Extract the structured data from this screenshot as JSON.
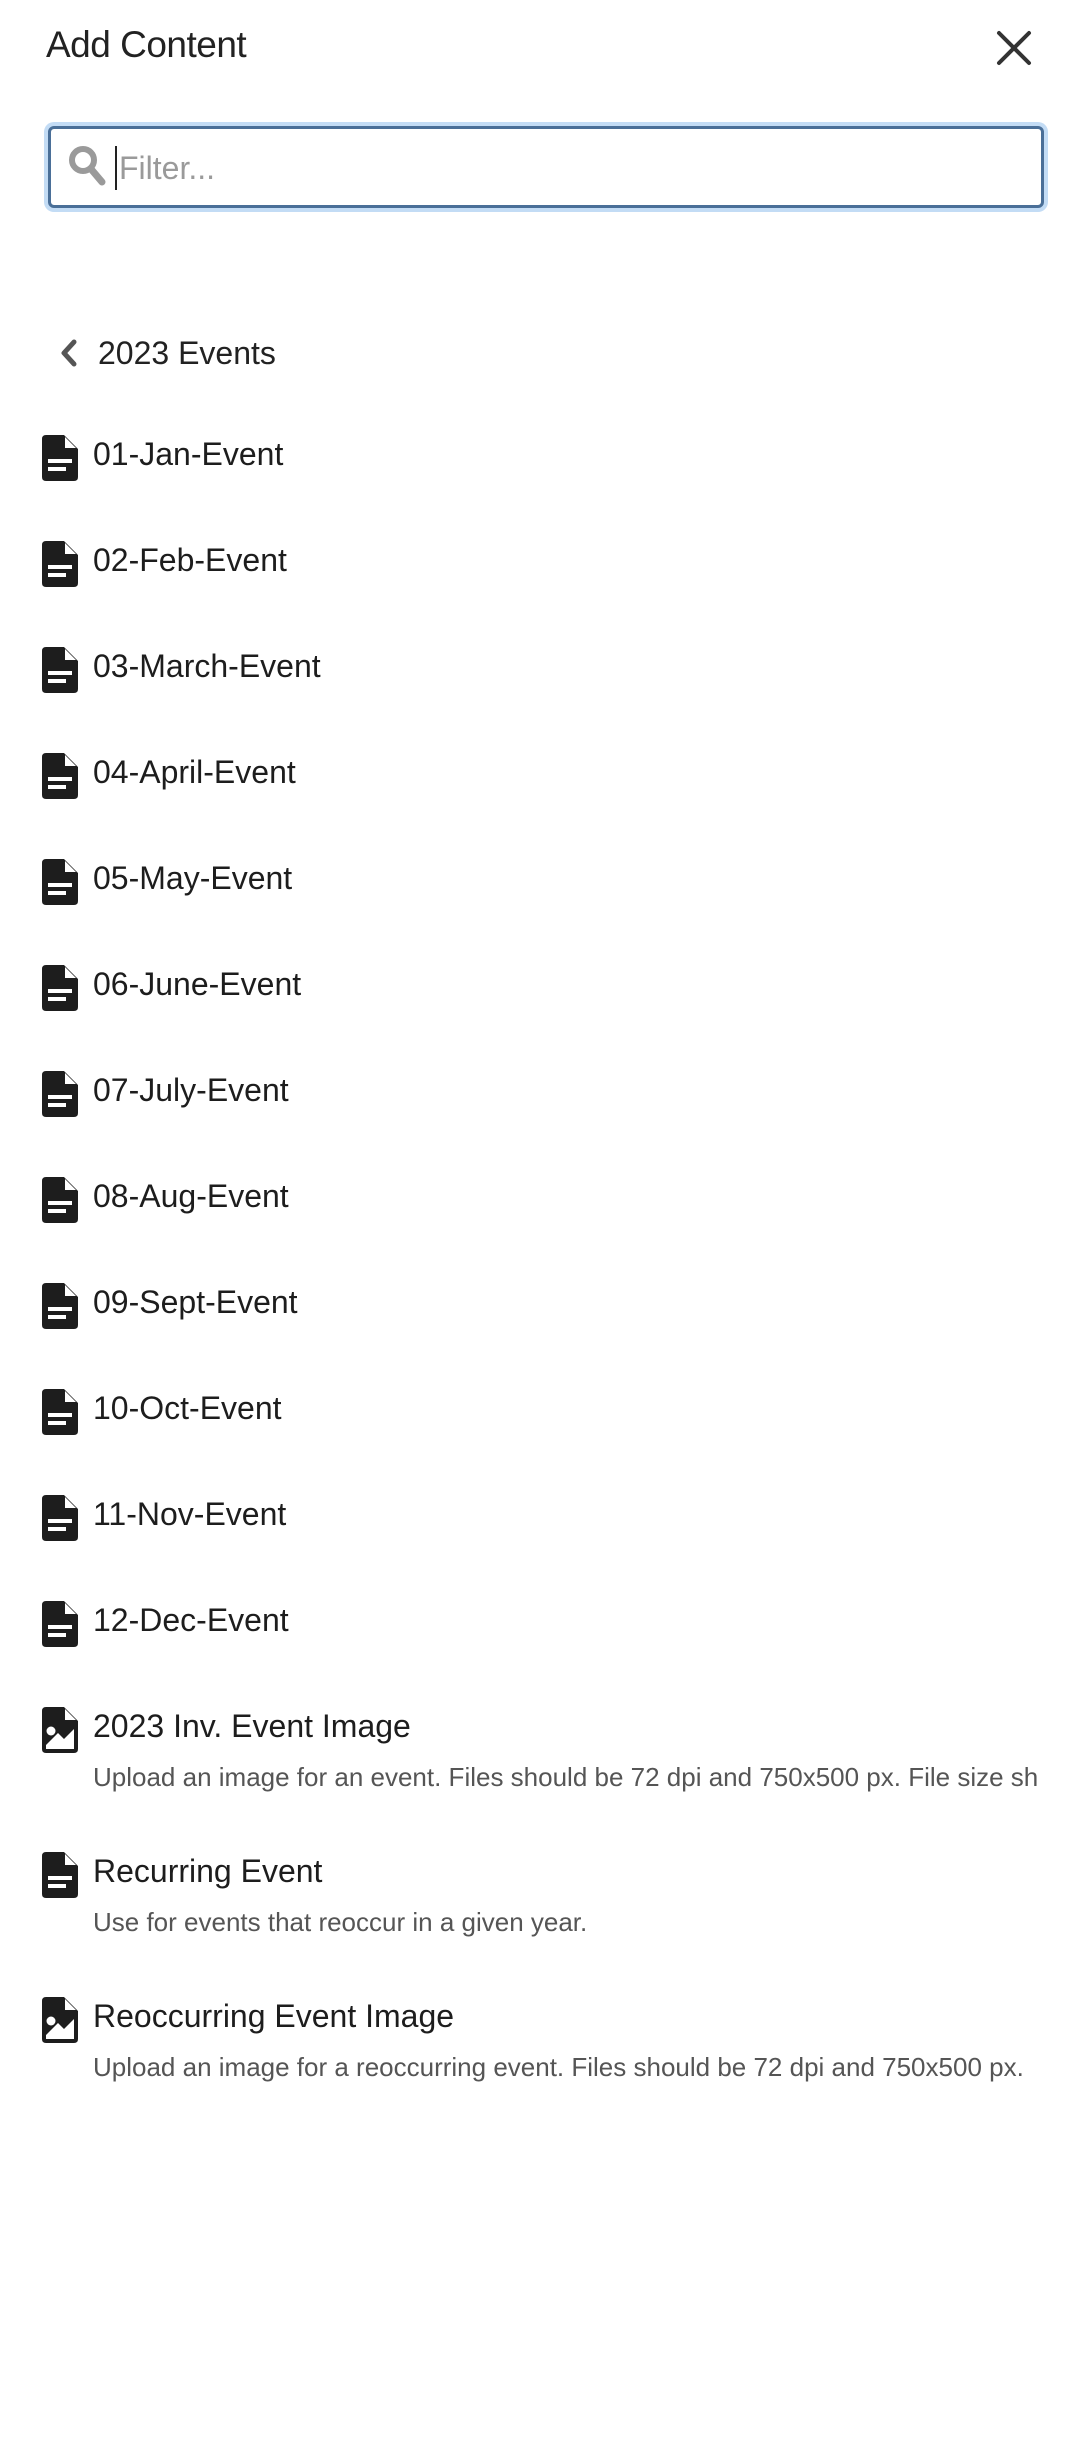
{
  "header": {
    "title": "Add Content",
    "close_icon": "close-icon"
  },
  "filter": {
    "placeholder": "Filter...",
    "value": "",
    "icon": "search-icon"
  },
  "breadcrumb": {
    "back_icon": "chevron-left-icon",
    "label": "2023 Events"
  },
  "items": [
    {
      "label": "01-Jan-Event",
      "icon": "document-icon",
      "description": ""
    },
    {
      "label": "02-Feb-Event",
      "icon": "document-icon",
      "description": ""
    },
    {
      "label": "03-March-Event",
      "icon": "document-icon",
      "description": ""
    },
    {
      "label": "04-April-Event",
      "icon": "document-icon",
      "description": ""
    },
    {
      "label": "05-May-Event",
      "icon": "document-icon",
      "description": ""
    },
    {
      "label": "06-June-Event",
      "icon": "document-icon",
      "description": ""
    },
    {
      "label": "07-July-Event",
      "icon": "document-icon",
      "description": ""
    },
    {
      "label": "08-Aug-Event",
      "icon": "document-icon",
      "description": ""
    },
    {
      "label": "09-Sept-Event",
      "icon": "document-icon",
      "description": ""
    },
    {
      "label": "10-Oct-Event",
      "icon": "document-icon",
      "description": ""
    },
    {
      "label": "11-Nov-Event",
      "icon": "document-icon",
      "description": ""
    },
    {
      "label": "12-Dec-Event",
      "icon": "document-icon",
      "description": ""
    },
    {
      "label": "2023 Inv. Event Image",
      "icon": "image-file-icon",
      "description": "Upload an image for an event. Files should be 72 dpi and 750x500 px. File size sh"
    },
    {
      "label": "Recurring Event",
      "icon": "document-icon",
      "description": "Use for events that reoccur in a given year."
    },
    {
      "label": "Reoccurring Event Image",
      "icon": "image-file-icon",
      "description": "Upload an image for a reoccurring event. Files should be 72 dpi and 750x500 px."
    }
  ],
  "colors": {
    "focus_ring": "#c3dcf5",
    "input_border": "#4a6f98",
    "icon": "#1d1d1d",
    "description_text": "#555555"
  }
}
